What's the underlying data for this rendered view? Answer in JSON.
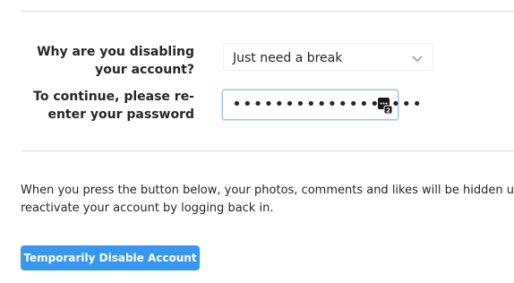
{
  "form": {
    "reason_label_line1": "Why are you disabling",
    "reason_label_line2": "your account?",
    "reason_selected": "Just need a break",
    "password_label_line1": "To continue, please re-",
    "password_label_line2": "enter your password",
    "password_masked": "••••••••••••••••••"
  },
  "notice": {
    "line1": "When you press the button below, your photos, comments and likes will be hidden until you",
    "line2": "reactivate your account by logging back in."
  },
  "actions": {
    "disable_label": "Temporarily Disable Account"
  },
  "icons": {
    "select": "chevron-down-icon",
    "password_manager": "password-manager-icon"
  },
  "colors": {
    "button": "#3897f0",
    "focus_border": "#9ec3ee"
  }
}
